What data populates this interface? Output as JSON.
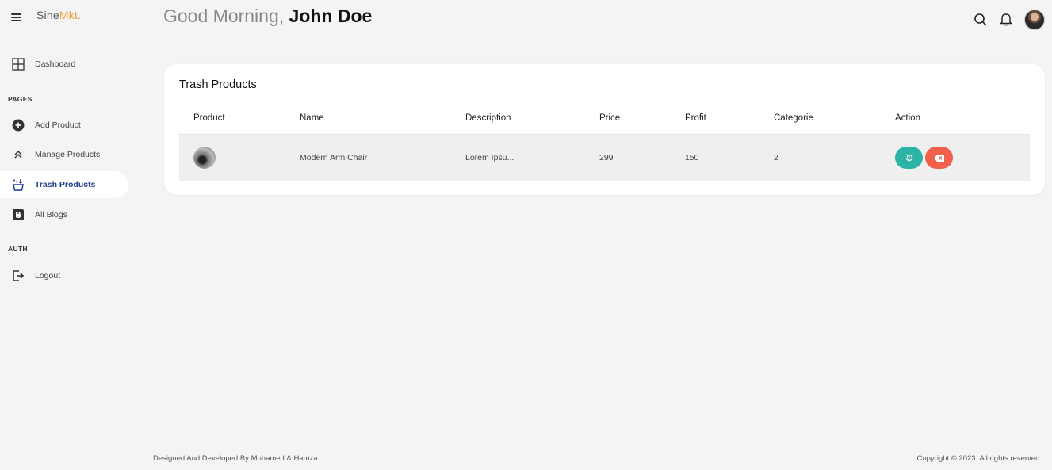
{
  "brand": {
    "name_part1": "Sine",
    "name_part2": "Mkt.",
    "accent_color": "#f0a33a"
  },
  "header": {
    "greeting": "Good Morning,",
    "user_name": "John Doe"
  },
  "sidebar": {
    "dashboard": {
      "label": "Dashboard",
      "icon": "grid-icon"
    },
    "section_pages": "PAGES",
    "items": [
      {
        "label": "Add Product",
        "icon": "plus-circle-icon"
      },
      {
        "label": "Manage Products",
        "icon": "chevrons-up-icon"
      },
      {
        "label": "Trash Products",
        "icon": "basket-icon",
        "active": true
      },
      {
        "label": "All Blogs",
        "icon": "blogger-icon"
      }
    ],
    "section_auth": "AUTH",
    "logout": {
      "label": "Logout",
      "icon": "logout-icon"
    }
  },
  "card": {
    "title": "Trash Products",
    "columns": [
      "Product",
      "Name",
      "Description",
      "Price",
      "Profit",
      "Categorie",
      "Action"
    ],
    "rows": [
      {
        "name": "Modern Arm Chair",
        "description": "Lorem Ipsu...",
        "price": "299",
        "profit": "150",
        "category": "2"
      }
    ],
    "action_colors": {
      "restore": "#2bb3a6",
      "delete": "#f0604d"
    }
  },
  "footer": {
    "credit": "Designed And Developed By Mohamed & Hamza",
    "copyright": "Copyright © 2023. All rights reserved."
  }
}
